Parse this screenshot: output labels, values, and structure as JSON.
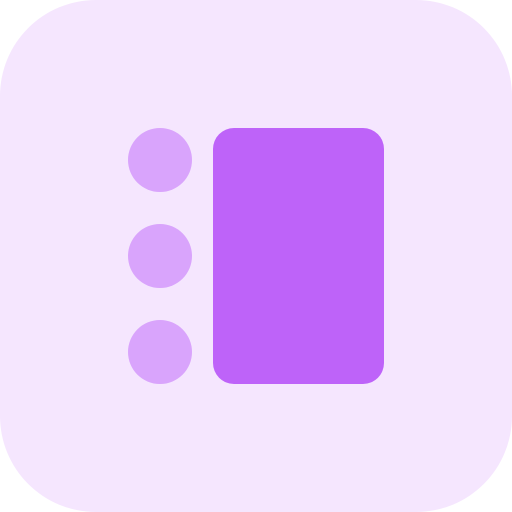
{
  "icon": {
    "name": "list-with-panel-icon",
    "colors": {
      "background": "#f5e6fe",
      "bullets": "#d9a4fc",
      "panel": "#be63f9"
    },
    "bullet_count": 3
  }
}
